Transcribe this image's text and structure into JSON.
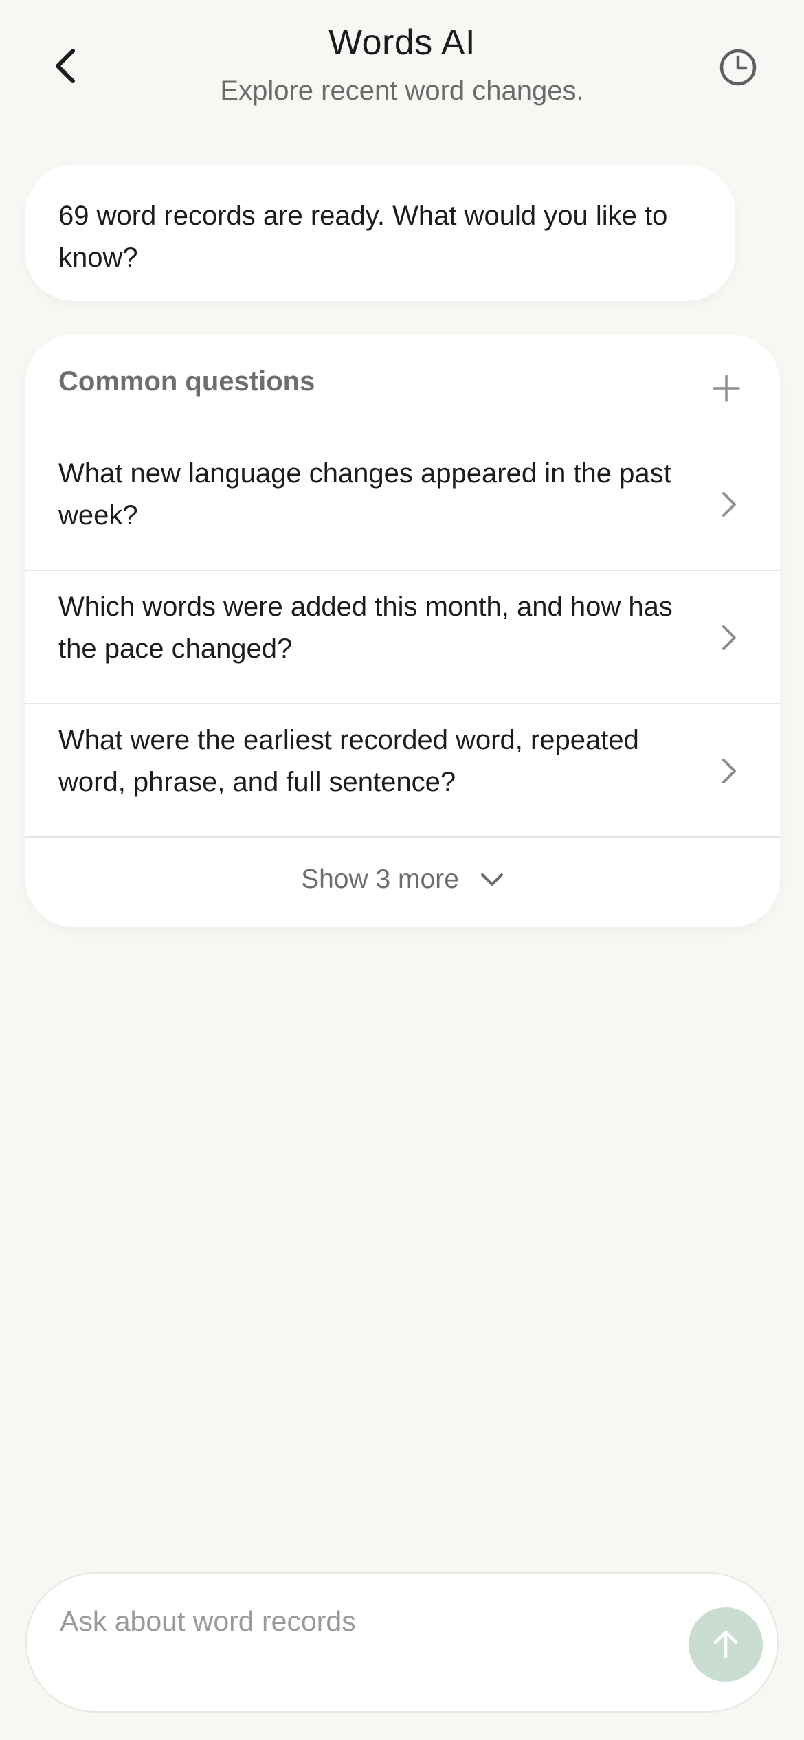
{
  "header": {
    "title": "Words AI",
    "subtitle": "Explore recent word changes.",
    "back_icon": "chevron-left-icon",
    "history_icon": "clock-icon"
  },
  "assistant_message": {
    "text": "69 word records are ready. What would you like to know?"
  },
  "common_questions": {
    "title": "Common questions",
    "add_icon": "plus-icon",
    "items": [
      {
        "text": "What new language changes appeared in the past week?"
      },
      {
        "text": "Which words were added this month, and how has the pace changed?"
      },
      {
        "text": "What were the earliest recorded word, repeated word, phrase, and full sentence?"
      }
    ],
    "show_more_label": "Show 3 more"
  },
  "composer": {
    "placeholder": "Ask about word records",
    "value": "",
    "send_icon": "arrow-up-icon"
  },
  "colors": {
    "background": "#f9f7f4",
    "card": "#ffffff",
    "send_button": "#c9ded1",
    "muted_text": "#6d6d72"
  }
}
